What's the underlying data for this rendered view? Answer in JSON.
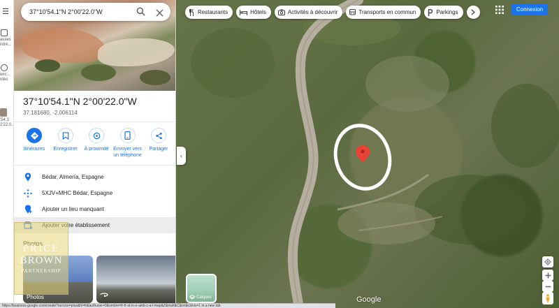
{
  "search": {
    "value": "37°10'54.1\"N 2°00'22.0\"W"
  },
  "rail": {
    "items": [
      {
        "label": "asses\nistré..."
      },
      {
        "label": "ierc...\nntes"
      },
      {
        "label": "'54.1\n2'22.0..."
      }
    ]
  },
  "place": {
    "title": "37°10'54.1\"N 2°00'22.0\"W",
    "decimal": "37.181680, -2.006114"
  },
  "actions": [
    {
      "label": "Itinéraires",
      "icon": "directions-icon"
    },
    {
      "label": "Enregistrer",
      "icon": "bookmark-icon"
    },
    {
      "label": "À proximité",
      "icon": "nearby-icon"
    },
    {
      "label": "Envoyer vers un téléphone",
      "icon": "phone-icon"
    },
    {
      "label": "Partager",
      "icon": "share-icon"
    }
  ],
  "info": {
    "address": "Bédar, Almería, Espagne",
    "plus_code": "5XJV+MHC Bédar, Espagne",
    "add_place": "Ajouter un lieu manquant",
    "add_business": "Ajouter votre établissement"
  },
  "photos": {
    "section_label": "Photos",
    "caption": "Photos"
  },
  "watermark": {
    "line1": "PRICE",
    "line2": "BROWN",
    "line3": "PARTNERSHIP"
  },
  "chips": [
    {
      "label": "Restaurants",
      "icon": "restaurant-icon"
    },
    {
      "label": "Hôtels",
      "icon": "hotel-icon"
    },
    {
      "label": "Activités à découvrir",
      "icon": "camera-icon"
    },
    {
      "label": "Transports en commun",
      "icon": "transit-icon"
    },
    {
      "label": "Parkings",
      "icon": "parking-icon"
    }
  ],
  "header": {
    "login_label": "Connexion"
  },
  "map": {
    "layers_label": "Calques",
    "logo": "Google",
    "marker_color": "#ea4335",
    "circle_color": "#ffffff"
  },
  "status": {
    "url": "https://business.google.com/create?service=plus&hl=fr&authuser=0&ombre=fr-fr-st-in-e-amb-c-a-l-map&Z&mult&C&on&ckinis=1 in a new tab"
  },
  "colors": {
    "accent": "#1a73e8",
    "text": "#202124",
    "secondary_text": "#5f6368"
  }
}
